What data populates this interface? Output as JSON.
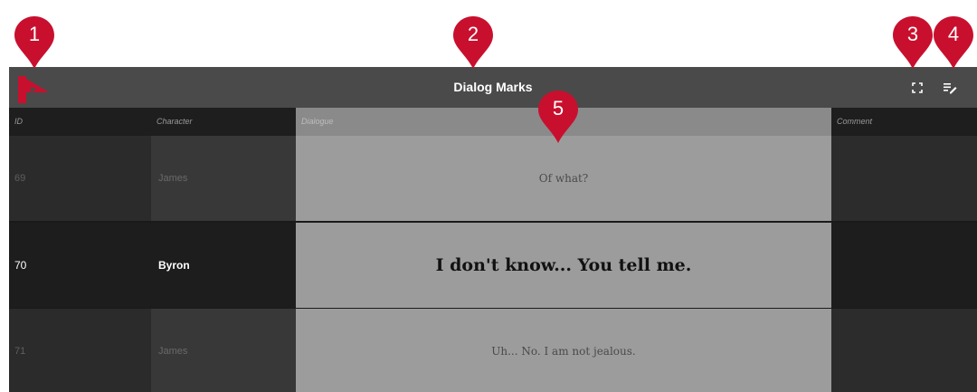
{
  "window": {
    "title": "Dialog Marks"
  },
  "toolbar": {
    "logo_icon": "play-logo-icon",
    "fullscreen_icon": "fullscreen-icon",
    "edit_icon": "edit-list-icon"
  },
  "columns": {
    "id": "ID",
    "character": "Character",
    "dialogue": "Dialogue",
    "comment": "Comment"
  },
  "rows": [
    {
      "id": "69",
      "character": "James",
      "dialogue": "Of what?",
      "comment": ""
    },
    {
      "id": "70",
      "character": "Byron",
      "dialogue": "I don't know... You tell me.",
      "comment": "",
      "current": true
    },
    {
      "id": "71",
      "character": "James",
      "dialogue": "Uh... No. I am not jealous.",
      "comment": ""
    }
  ],
  "callouts": [
    "1",
    "2",
    "3",
    "4",
    "5"
  ],
  "colors": {
    "marker": "#c8102e",
    "titlebar": "#4a4a4a",
    "dialogue_column": "#9c9c9c",
    "logo": "#c8102e"
  }
}
